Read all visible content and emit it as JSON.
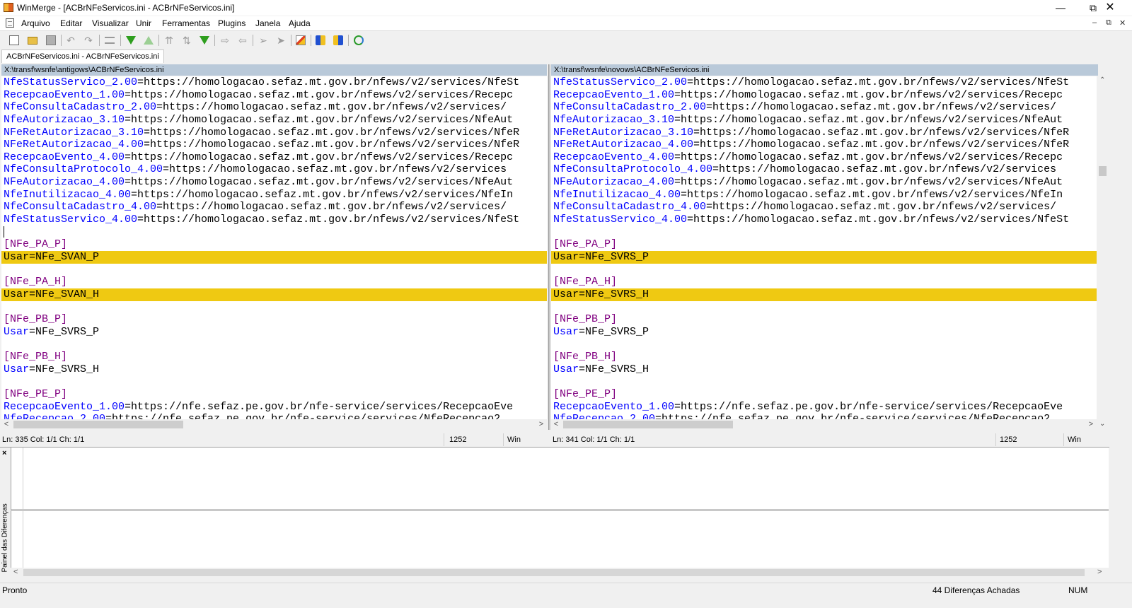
{
  "window": {
    "title": "WinMerge - [ACBrNFeServicos.ini - ACBrNFeServicos.ini]"
  },
  "menu": [
    "Arquivo",
    "Editar",
    "Visualizar",
    "Unir",
    "Ferramentas",
    "Plugins",
    "Janela",
    "Ajuda"
  ],
  "toolbar_icons": [
    "new-icon",
    "open-icon",
    "save-icon",
    "undo-icon",
    "redo-icon",
    "options-icon",
    "next-diff-icon",
    "prev-diff-icon",
    "first-diff-icon",
    "current-diff-icon",
    "last-diff-icon",
    "copy-right-icon",
    "copy-left-icon",
    "copy-right-advance-icon",
    "copy-left-advance-icon",
    "edit-icon",
    "copy-all-right-icon",
    "copy-all-left-icon",
    "refresh-icon"
  ],
  "doc_tab": "ACBrNFeServicos.ini - ACBrNFeServicos.ini",
  "colors": {
    "diff_highlight": "#efc912",
    "key": "#0000ff",
    "section": "#800080",
    "pane_header": "#b9c9d9"
  },
  "left": {
    "path": "X:\\transf\\wsnfe\\antigows\\ACBrNFeServicos.ini",
    "lines": [
      {
        "k": "NfeStatusServico_2.00",
        "v": "=https://homologacao.sefaz.mt.gov.br/nfews/v2/services/NfeSt"
      },
      {
        "k": "RecepcaoEvento_1.00",
        "v": "=https://homologacao.sefaz.mt.gov.br/nfews/v2/services/Recepc"
      },
      {
        "k": "NfeConsultaCadastro_2.00",
        "v": "=https://homologacao.sefaz.mt.gov.br/nfews/v2/services/"
      },
      {
        "k": "NfeAutorizacao_3.10",
        "v": "=https://homologacao.sefaz.mt.gov.br/nfews/v2/services/NfeAut"
      },
      {
        "k": "NFeRetAutorizacao_3.10",
        "v": "=https://homologacao.sefaz.mt.gov.br/nfews/v2/services/NfeR"
      },
      {
        "k": "NFeRetAutorizacao_4.00",
        "v": "=https://homologacao.sefaz.mt.gov.br/nfews/v2/services/NfeR"
      },
      {
        "k": "RecepcaoEvento_4.00",
        "v": "=https://homologacao.sefaz.mt.gov.br/nfews/v2/services/Recepc"
      },
      {
        "k": "NfeConsultaProtocolo_4.00",
        "v": "=https://homologacao.sefaz.mt.gov.br/nfews/v2/services"
      },
      {
        "k": "NFeAutorizacao_4.00",
        "v": "=https://homologacao.sefaz.mt.gov.br/nfews/v2/services/NfeAut"
      },
      {
        "k": "NfeInutilizacao_4.00",
        "v": "=https://homologacao.sefaz.mt.gov.br/nfews/v2/services/NfeIn"
      },
      {
        "k": "NfeConsultaCadastro_4.00",
        "v": "=https://homologacao.sefaz.mt.gov.br/nfews/v2/services/"
      },
      {
        "k": "NfeStatusServico_4.00",
        "v": "=https://homologacao.sefaz.mt.gov.br/nfews/v2/services/NfeSt"
      },
      {
        "cursor": true
      },
      {
        "sec": "[NFe_PA_P]"
      },
      {
        "raw": "Usar=NFe_SVAN_P",
        "diff": true
      },
      {},
      {
        "sec": "[NFe_PA_H]"
      },
      {
        "raw": "Usar=NFe_SVAN_H",
        "diff": true
      },
      {},
      {
        "sec": "[NFe_PB_P]"
      },
      {
        "k": "Usar",
        "v": "=NFe_SVRS_P"
      },
      {},
      {
        "sec": "[NFe_PB_H]"
      },
      {
        "k": "Usar",
        "v": "=NFe_SVRS_H"
      },
      {},
      {
        "sec": "[NFe_PE_P]"
      },
      {
        "k": "RecepcaoEvento_1.00",
        "v": "=https://nfe.sefaz.pe.gov.br/nfe-service/services/RecepcaoEve"
      },
      {
        "k": "NfeRecepcao_2.00",
        "v": "=https://nfe.sefaz.pe.gov.br/nfe-service/services/NfeRecepcao2",
        "partial": true
      }
    ],
    "status": {
      "pos": "Ln: 335  Col: 1/1  Ch: 1/1",
      "codepage": "1252",
      "eol": "Win"
    }
  },
  "right": {
    "path": "X:\\transf\\wsnfe\\novows\\ACBrNFeServicos.ini",
    "lines": [
      {
        "k": "NfeStatusServico_2.00",
        "v": "=https://homologacao.sefaz.mt.gov.br/nfews/v2/services/NfeSt"
      },
      {
        "k": "RecepcaoEvento_1.00",
        "v": "=https://homologacao.sefaz.mt.gov.br/nfews/v2/services/Recepc"
      },
      {
        "k": "NfeConsultaCadastro_2.00",
        "v": "=https://homologacao.sefaz.mt.gov.br/nfews/v2/services/"
      },
      {
        "k": "NfeAutorizacao_3.10",
        "v": "=https://homologacao.sefaz.mt.gov.br/nfews/v2/services/NfeAut"
      },
      {
        "k": "NFeRetAutorizacao_3.10",
        "v": "=https://homologacao.sefaz.mt.gov.br/nfews/v2/services/NfeR"
      },
      {
        "k": "NFeRetAutorizacao_4.00",
        "v": "=https://homologacao.sefaz.mt.gov.br/nfews/v2/services/NfeR"
      },
      {
        "k": "RecepcaoEvento_4.00",
        "v": "=https://homologacao.sefaz.mt.gov.br/nfews/v2/services/Recepc"
      },
      {
        "k": "NfeConsultaProtocolo_4.00",
        "v": "=https://homologacao.sefaz.mt.gov.br/nfews/v2/services"
      },
      {
        "k": "NFeAutorizacao_4.00",
        "v": "=https://homologacao.sefaz.mt.gov.br/nfews/v2/services/NfeAut"
      },
      {
        "k": "NfeInutilizacao_4.00",
        "v": "=https://homologacao.sefaz.mt.gov.br/nfews/v2/services/NfeIn"
      },
      {
        "k": "NfeConsultaCadastro_4.00",
        "v": "=https://homologacao.sefaz.mt.gov.br/nfews/v2/services/"
      },
      {
        "k": "NfeStatusServico_4.00",
        "v": "=https://homologacao.sefaz.mt.gov.br/nfews/v2/services/NfeSt"
      },
      {},
      {
        "sec": "[NFe_PA_P]"
      },
      {
        "raw": "Usar=NFe_SVRS_P",
        "diff": true
      },
      {},
      {
        "sec": "[NFe_PA_H]"
      },
      {
        "raw": "Usar=NFe_SVRS_H",
        "diff": true
      },
      {},
      {
        "sec": "[NFe_PB_P]"
      },
      {
        "k": "Usar",
        "v": "=NFe_SVRS_P"
      },
      {},
      {
        "sec": "[NFe_PB_H]"
      },
      {
        "k": "Usar",
        "v": "=NFe_SVRS_H"
      },
      {},
      {
        "sec": "[NFe_PE_P]"
      },
      {
        "k": "RecepcaoEvento_1.00",
        "v": "=https://nfe.sefaz.pe.gov.br/nfe-service/services/RecepcaoEve"
      },
      {
        "k": "NfeRecepcao_2.00",
        "v": "=https://nfe.sefaz.pe.gov.br/nfe-service/services/NfeRecepcao2",
        "partial": true
      }
    ],
    "status": {
      "pos": "Ln: 341  Col: 1/1  Ch: 1/1",
      "codepage": "1252",
      "eol": "Win"
    }
  },
  "diff_panel": {
    "close": "×",
    "label": "Painel das Diferenças"
  },
  "statusbar": {
    "ready": "Pronto",
    "diffs": "44 Diferenças Achadas",
    "num": "NUM"
  }
}
